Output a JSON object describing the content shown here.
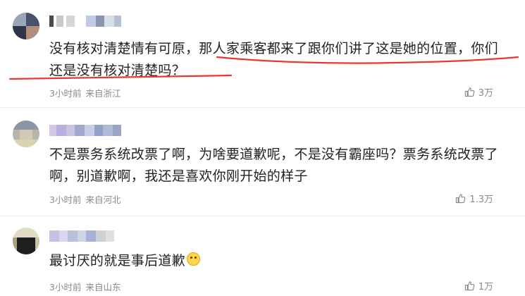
{
  "comments": [
    {
      "text_line1": "没有核对清楚情有可原，那人家乘客都来了跟你们讲了这是她的位置，你们",
      "text_line2": "还是没有核对清楚吗？",
      "time": "3小时前",
      "location": "来自浙江",
      "likes": "3万"
    },
    {
      "text_line1": "不是票务系统改票了啊，为啥要道歉呢，不是没有霸座吗？票务系统改票了",
      "text_line2": "啊，别道歉啊，我还是喜欢你刚开始的样子",
      "time": "3小时前",
      "location": "来自河北",
      "likes": "1.3万"
    },
    {
      "text_line1": "最讨厌的就是事后道歉",
      "time": "3小时前",
      "location": "来自山东",
      "likes": "1万"
    }
  ],
  "colors": {
    "annotation_red": "#e53935",
    "meta_gray": "#8a8a8a"
  },
  "icons": {
    "like": "thumbs-up-icon",
    "emoji": "smiling-emoji-icon"
  }
}
